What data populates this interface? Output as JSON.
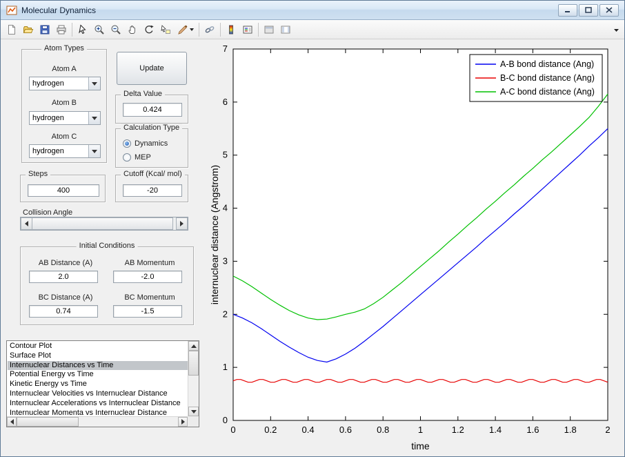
{
  "window": {
    "title": "Molecular Dynamics"
  },
  "window_controls": [
    "minimize",
    "maximize",
    "close"
  ],
  "toolbar": {
    "icons": [
      "new-figure",
      "open-file",
      "save-figure",
      "print-figure",
      "edit-plot",
      "zoom-in",
      "zoom-out",
      "pan",
      "rotate-3d",
      "data-cursor",
      "brush",
      "link-plot",
      "insert-colorbar",
      "insert-legend",
      "hide-plot-tools",
      "show-plot-tools"
    ]
  },
  "controls": {
    "atom_types": {
      "title": "Atom Types",
      "atom_a_label": "Atom A",
      "atom_a_value": "hydrogen",
      "atom_b_label": "Atom B",
      "atom_b_value": "hydrogen",
      "atom_c_label": "Atom C",
      "atom_c_value": "hydrogen"
    },
    "update_button": "Update",
    "delta": {
      "title": "Delta Value",
      "value": "0.424"
    },
    "calculation_type": {
      "title": "Calculation Type",
      "options": [
        {
          "label": "Dynamics",
          "selected": true
        },
        {
          "label": "MEP",
          "selected": false
        }
      ]
    },
    "steps": {
      "title": "Steps",
      "value": "400"
    },
    "cutoff": {
      "title": "Cutoff (Kcal/ mol)",
      "value": "-20"
    },
    "collision_angle": {
      "label": "Collision Angle"
    },
    "initial_conditions": {
      "title": "Initial Conditions",
      "fields": [
        {
          "label": "AB Distance (A)",
          "value": "2.0"
        },
        {
          "label": "AB Momentum",
          "value": "-2.0"
        },
        {
          "label": "BC Distance (A)",
          "value": "0.74"
        },
        {
          "label": "BC Momentum",
          "value": "-1.5"
        }
      ]
    },
    "plot_list": {
      "items": [
        "Contour Plot",
        "Surface Plot",
        "Internuclear Distances vs Time",
        "Potential Energy vs Time",
        "Kinetic Energy vs Time",
        "Internuclear Velocities vs Internuclear Distance",
        "Internuclear Accelerations vs Internuclear Distance",
        "Internuclear Momenta vs Internuclear Distance"
      ],
      "selected_index": 2
    }
  },
  "chart_data": {
    "type": "line",
    "title": "",
    "xlabel": "time",
    "ylabel": "internuclear distance (Angstrom)",
    "xlim": [
      0,
      2
    ],
    "ylim": [
      0,
      7
    ],
    "xticks": [
      0,
      0.2,
      0.4,
      0.6,
      0.8,
      1,
      1.2,
      1.4,
      1.6,
      1.8,
      2
    ],
    "yticks": [
      0,
      1,
      2,
      3,
      4,
      5,
      6,
      7
    ],
    "grid": false,
    "legend_position": "top-right",
    "series": [
      {
        "name": "A-B bond distance (Ang)",
        "color": "#0000f0",
        "x": [
          0,
          0.05,
          0.1,
          0.15,
          0.2,
          0.25,
          0.3,
          0.35,
          0.4,
          0.45,
          0.5,
          0.55,
          0.6,
          0.65,
          0.7,
          0.75,
          0.8,
          0.85,
          0.9,
          0.95,
          1,
          1.05,
          1.1,
          1.15,
          1.2,
          1.25,
          1.3,
          1.35,
          1.4,
          1.45,
          1.5,
          1.55,
          1.6,
          1.65,
          1.7,
          1.75,
          1.8,
          1.85,
          1.9,
          1.95,
          2
        ],
        "y": [
          2.0,
          1.93,
          1.84,
          1.73,
          1.61,
          1.49,
          1.38,
          1.28,
          1.19,
          1.13,
          1.1,
          1.16,
          1.25,
          1.36,
          1.49,
          1.63,
          1.77,
          1.92,
          2.07,
          2.22,
          2.37,
          2.52,
          2.67,
          2.82,
          2.97,
          3.12,
          3.27,
          3.43,
          3.58,
          3.73,
          3.89,
          4.04,
          4.2,
          4.36,
          4.52,
          4.68,
          4.84,
          5.0,
          5.17,
          5.33,
          5.5
        ]
      },
      {
        "name": "B-C bond distance (Ang)",
        "color": "#e80000",
        "x": [
          0,
          0.02,
          0.04,
          0.06,
          0.08,
          0.1,
          0.12,
          0.14,
          0.16,
          0.18,
          0.2,
          0.22,
          0.24,
          0.26,
          0.28,
          0.3,
          0.32,
          0.34,
          0.36,
          0.38,
          0.4,
          0.42,
          0.44,
          0.46,
          0.48,
          0.5,
          0.52,
          0.54,
          0.56,
          0.58,
          0.6,
          0.62,
          0.64,
          0.66,
          0.68,
          0.7,
          0.72,
          0.74,
          0.76,
          0.78,
          0.8,
          0.82,
          0.84,
          0.86,
          0.88,
          0.9,
          0.92,
          0.94,
          0.96,
          0.98,
          1,
          1.02,
          1.04,
          1.06,
          1.08,
          1.1,
          1.12,
          1.14,
          1.16,
          1.18,
          1.2,
          1.22,
          1.24,
          1.26,
          1.28,
          1.3,
          1.32,
          1.34,
          1.36,
          1.38,
          1.4,
          1.42,
          1.44,
          1.46,
          1.48,
          1.5,
          1.52,
          1.54,
          1.56,
          1.58,
          1.6,
          1.62,
          1.64,
          1.66,
          1.68,
          1.7,
          1.72,
          1.74,
          1.76,
          1.78,
          1.8,
          1.82,
          1.84,
          1.86,
          1.88,
          1.9,
          1.92,
          1.94,
          1.96,
          1.98,
          2
        ],
        "y": [
          0.745,
          0.771,
          0.771,
          0.745,
          0.719,
          0.719,
          0.745,
          0.771,
          0.771,
          0.745,
          0.719,
          0.719,
          0.745,
          0.771,
          0.771,
          0.745,
          0.719,
          0.719,
          0.745,
          0.771,
          0.771,
          0.745,
          0.719,
          0.719,
          0.745,
          0.771,
          0.771,
          0.745,
          0.719,
          0.719,
          0.745,
          0.771,
          0.771,
          0.745,
          0.719,
          0.719,
          0.745,
          0.771,
          0.771,
          0.745,
          0.719,
          0.719,
          0.745,
          0.771,
          0.771,
          0.745,
          0.719,
          0.719,
          0.745,
          0.771,
          0.771,
          0.745,
          0.719,
          0.719,
          0.745,
          0.771,
          0.771,
          0.745,
          0.719,
          0.719,
          0.745,
          0.771,
          0.771,
          0.745,
          0.719,
          0.719,
          0.745,
          0.771,
          0.771,
          0.745,
          0.719,
          0.719,
          0.745,
          0.771,
          0.771,
          0.745,
          0.719,
          0.719,
          0.745,
          0.771,
          0.771,
          0.745,
          0.719,
          0.719,
          0.745,
          0.771,
          0.771,
          0.745,
          0.719,
          0.719,
          0.745,
          0.771,
          0.771,
          0.745,
          0.719,
          0.719,
          0.745,
          0.771,
          0.771,
          0.745,
          0.719
        ]
      },
      {
        "name": "A-C bond distance (Ang)",
        "color": "#00c000",
        "x": [
          0,
          0.05,
          0.1,
          0.15,
          0.2,
          0.25,
          0.3,
          0.35,
          0.4,
          0.45,
          0.5,
          0.55,
          0.6,
          0.65,
          0.7,
          0.75,
          0.8,
          0.85,
          0.9,
          0.95,
          1,
          1.05,
          1.1,
          1.15,
          1.2,
          1.25,
          1.3,
          1.35,
          1.4,
          1.45,
          1.5,
          1.55,
          1.6,
          1.65,
          1.7,
          1.75,
          1.8,
          1.85,
          1.9,
          1.95,
          2
        ],
        "y": [
          2.72,
          2.63,
          2.52,
          2.4,
          2.28,
          2.17,
          2.07,
          1.99,
          1.93,
          1.9,
          1.91,
          1.95,
          2.0,
          2.04,
          2.1,
          2.2,
          2.32,
          2.46,
          2.6,
          2.75,
          2.9,
          3.05,
          3.2,
          3.36,
          3.51,
          3.67,
          3.82,
          3.98,
          4.13,
          4.29,
          4.44,
          4.6,
          4.75,
          4.91,
          5.06,
          5.22,
          5.38,
          5.54,
          5.71,
          5.92,
          6.15
        ]
      }
    ]
  }
}
